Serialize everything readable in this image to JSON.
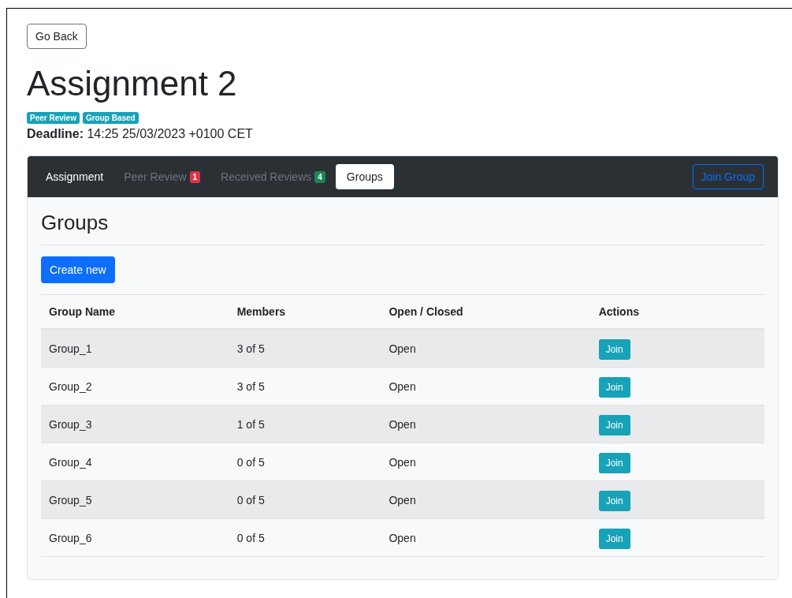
{
  "back_button": "Go Back",
  "title": "Assignment 2",
  "tags": [
    "Peer Review",
    "Group Based"
  ],
  "deadline": {
    "label": "Deadline:",
    "value": "14:25 25/03/2023 +0100 CET"
  },
  "tabs": [
    {
      "label": "Assignment",
      "selected": false,
      "disabled": false
    },
    {
      "label": "Peer Review",
      "selected": false,
      "disabled": true,
      "badge": "1",
      "color": "#dc3545"
    },
    {
      "label": "Received Reviews",
      "selected": false,
      "disabled": true,
      "badge": "4",
      "color": "#198754"
    },
    {
      "label": "Groups",
      "selected": true,
      "disabled": false
    }
  ],
  "join_group_button": "Join Group",
  "section_title": "Groups",
  "create_button": "Create new",
  "table": {
    "columns": [
      "Group Name",
      "Members",
      "Open / Closed",
      "Actions"
    ],
    "rows": [
      {
        "name": "Group_1",
        "members": "3 of 5",
        "status": "Open",
        "action": "Join"
      },
      {
        "name": "Group_2",
        "members": "3 of 5",
        "status": "Open",
        "action": "Join"
      },
      {
        "name": "Group_3",
        "members": "1 of 5",
        "status": "Open",
        "action": "Join"
      },
      {
        "name": "Group_4",
        "members": "0 of 5",
        "status": "Open",
        "action": "Join"
      },
      {
        "name": "Group_5",
        "members": "0 of 5",
        "status": "Open",
        "action": "Join"
      },
      {
        "name": "Group_6",
        "members": "0 of 5",
        "status": "Open",
        "action": "Join"
      }
    ]
  }
}
